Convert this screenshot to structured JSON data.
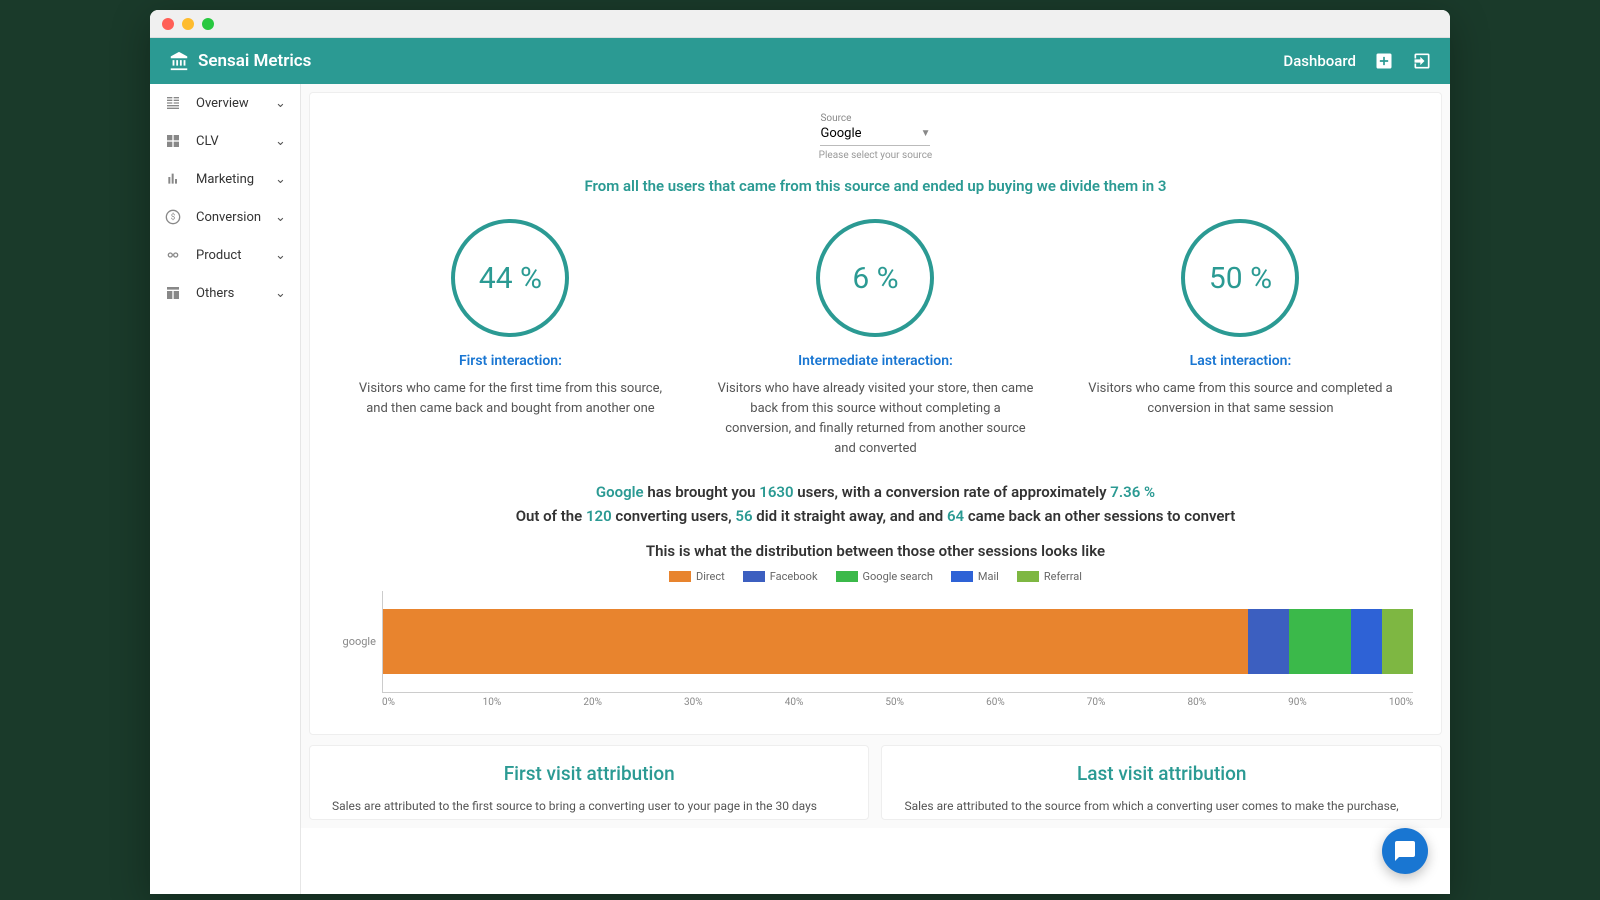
{
  "brand": "Sensai Metrics",
  "topbar": {
    "dashboard": "Dashboard"
  },
  "sidebar": {
    "items": [
      {
        "label": "Overview"
      },
      {
        "label": "CLV"
      },
      {
        "label": "Marketing"
      },
      {
        "label": "Conversion"
      },
      {
        "label": "Product"
      },
      {
        "label": "Others"
      }
    ]
  },
  "source": {
    "label": "Source",
    "value": "Google",
    "hint": "Please select your source"
  },
  "lead": "From all the users that came from this source and ended up buying we divide them in 3",
  "circles": [
    {
      "pct": "44 %",
      "title": "First interaction:",
      "desc": "Visitors who came for the first time from this source, and then came back and bought from another one"
    },
    {
      "pct": "6 %",
      "title": "Intermediate interaction:",
      "desc": "Visitors who have already visited your store, then came back from this source without completing a conversion, and finally returned from another source and converted"
    },
    {
      "pct": "50 %",
      "title": "Last interaction:",
      "desc": "Visitors who came from this source and completed a conversion in that same session"
    }
  ],
  "summary": {
    "source": "Google",
    "t1": " has brought you ",
    "users": "1630",
    "t2": " users, with a conversion rate of approximately ",
    "rate": "7.36 %",
    "t3": "Out of the ",
    "converting": "120",
    "t4": " converting users, ",
    "straight": "56",
    "t5": " did it straight away, and and ",
    "returned": "64",
    "t6": " came back an other sessions to convert"
  },
  "dist_title": "This is what the distribution between those other sessions looks like",
  "chart_data": {
    "type": "bar",
    "orientation": "horizontal-stacked",
    "categories": [
      "google"
    ],
    "series": [
      {
        "name": "Direct",
        "color": "#e8842e",
        "values": [
          84
        ]
      },
      {
        "name": "Facebook",
        "color": "#3c5fc0",
        "values": [
          4
        ]
      },
      {
        "name": "Google search",
        "color": "#3bb94a",
        "values": [
          6
        ]
      },
      {
        "name": "Mail",
        "color": "#2e62d6",
        "values": [
          3
        ]
      },
      {
        "name": "Referral",
        "color": "#7eb742",
        "values": [
          3
        ]
      }
    ],
    "xlim": [
      0,
      100
    ],
    "xticks": [
      "0%",
      "10%",
      "20%",
      "30%",
      "40%",
      "50%",
      "60%",
      "70%",
      "80%",
      "90%",
      "100%"
    ],
    "xlabel": "",
    "ylabel": "",
    "title": ""
  },
  "bottom": {
    "first": {
      "title": "First visit attribution",
      "body": "Sales are attributed to the first source to bring a converting user to your page in the 30 days"
    },
    "last": {
      "title": "Last visit attribution",
      "body": "Sales are attributed to the source from which a converting user comes to make the purchase,"
    }
  }
}
